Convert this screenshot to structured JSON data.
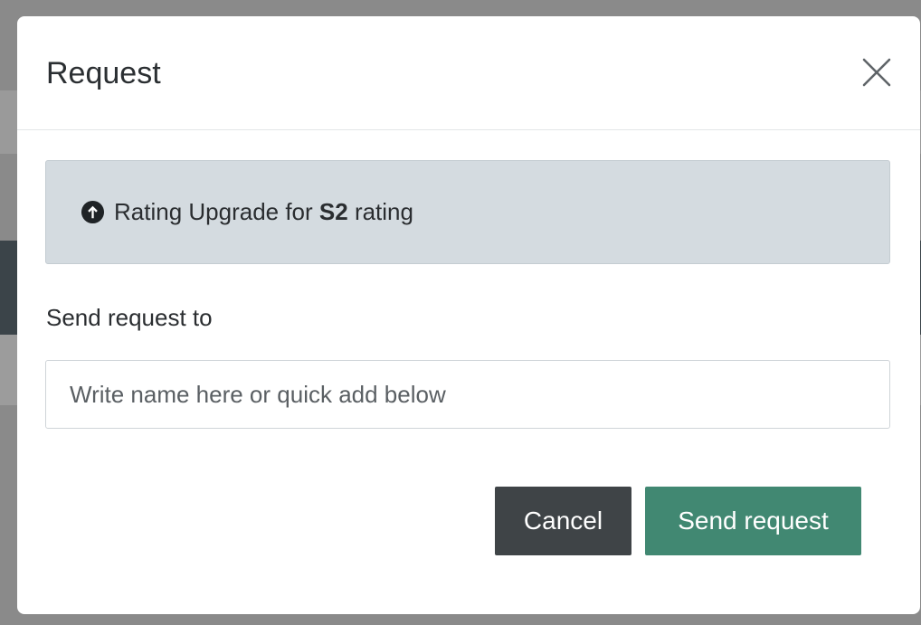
{
  "modal": {
    "title": "Request",
    "info": {
      "icon": "arrow-up-circle-icon",
      "prefix": "Rating Upgrade for ",
      "code": "S2",
      "suffix": " rating"
    },
    "field_label": "Send request to",
    "input": {
      "value": "",
      "placeholder": "Write name here or quick add below"
    },
    "buttons": {
      "cancel_label": "Cancel",
      "send_label": "Send request"
    }
  },
  "colors": {
    "info_bg": "#d4dbe0",
    "cancel_bg": "#3f4447",
    "send_bg": "#418872"
  }
}
